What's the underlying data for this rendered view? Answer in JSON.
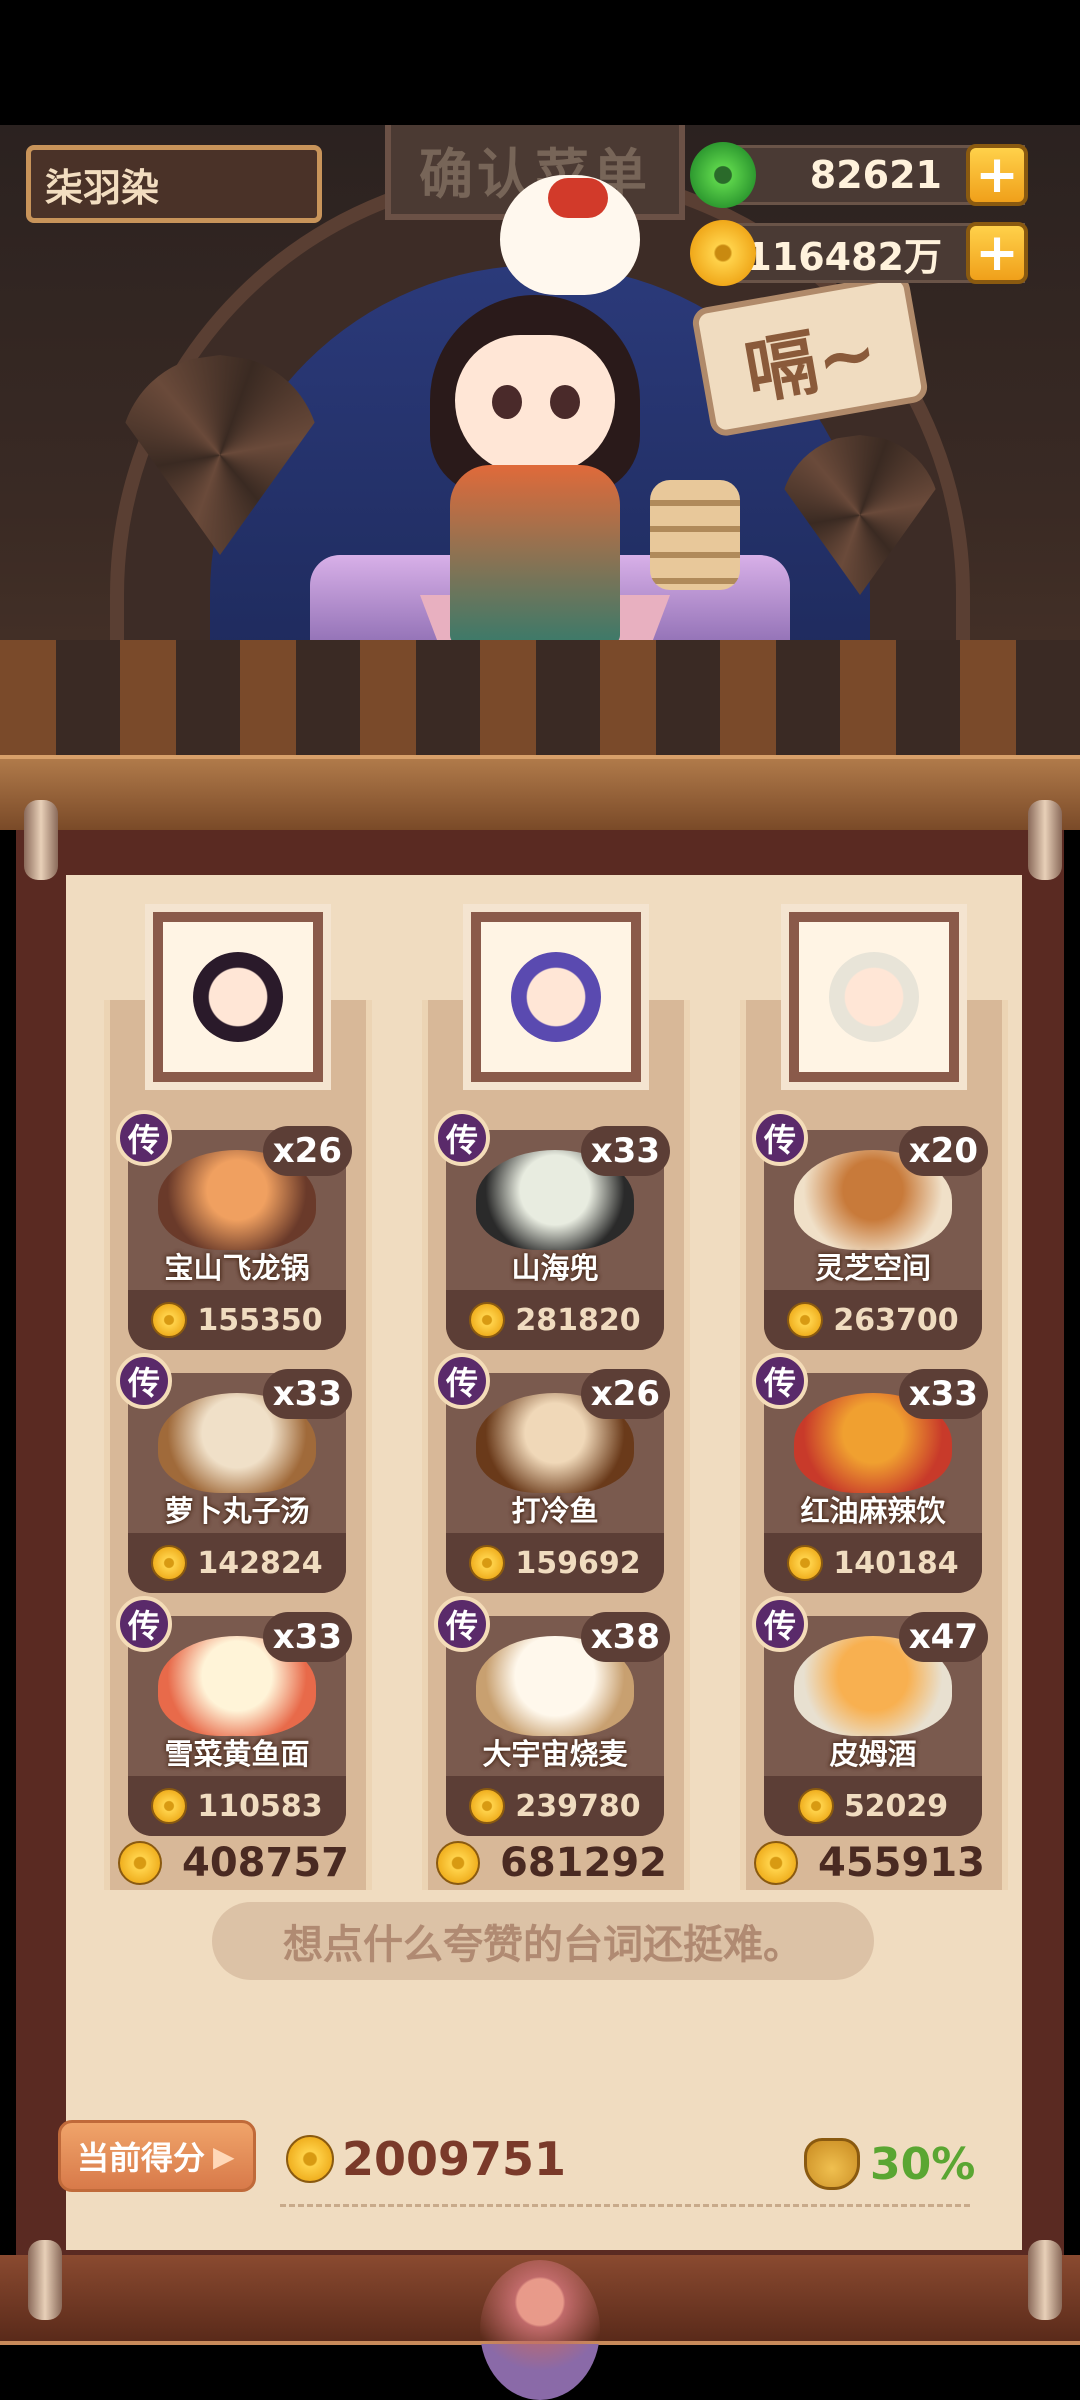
{
  "player": {
    "name": "柒羽染"
  },
  "currency": {
    "jade": "82621",
    "coins": "116482万"
  },
  "speech": "嗝~",
  "sign": "确认菜单",
  "columns": [
    {
      "dishes": [
        {
          "badge": "传",
          "qty": "x26",
          "name": "宝山飞龙锅",
          "price": "155350"
        },
        {
          "badge": "传",
          "qty": "x33",
          "name": "萝卜丸子汤",
          "price": "142824"
        },
        {
          "badge": "传",
          "qty": "x33",
          "name": "雪菜黄鱼面",
          "price": "110583"
        }
      ],
      "total": "408757"
    },
    {
      "dishes": [
        {
          "badge": "传",
          "qty": "x33",
          "name": "山海兜",
          "price": "281820"
        },
        {
          "badge": "传",
          "qty": "x26",
          "name": "打冷鱼",
          "price": "159692"
        },
        {
          "badge": "传",
          "qty": "x38",
          "name": "大宇宙烧麦",
          "price": "239780"
        }
      ],
      "total": "681292"
    },
    {
      "dishes": [
        {
          "badge": "传",
          "qty": "x20",
          "name": "灵芝空间",
          "price": "263700"
        },
        {
          "badge": "传",
          "qty": "x33",
          "name": "红油麻辣饮",
          "price": "140184"
        },
        {
          "badge": "传",
          "qty": "x47",
          "name": "皮姆酒",
          "price": "52029"
        }
      ],
      "total": "455913"
    }
  ],
  "quote": "想点什么夸赞的台词还挺难。",
  "score": {
    "button_label": "当前得分",
    "value": "2009751",
    "bonus": "30%"
  },
  "colors": {
    "accent": "#f0a01a",
    "bonus": "#5aa632",
    "scroll": "#5a2a22",
    "paper": "#f0dcc0"
  }
}
